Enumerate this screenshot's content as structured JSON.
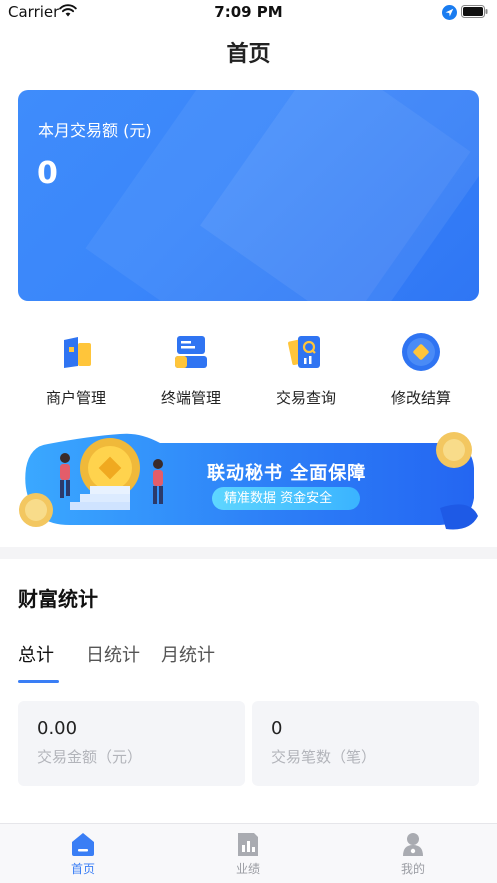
{
  "status_bar": {
    "carrier": "Carrier",
    "time": "7:09 PM"
  },
  "nav": {
    "title": "首页"
  },
  "summary_card": {
    "label": "本月交易额 (元)",
    "value": "0"
  },
  "quick_menu": [
    {
      "label": "商户管理",
      "icon": "merchant-icon"
    },
    {
      "label": "终端管理",
      "icon": "terminal-icon"
    },
    {
      "label": "交易查询",
      "icon": "transaction-search-icon"
    },
    {
      "label": "修改结算",
      "icon": "settlement-icon"
    }
  ],
  "banner": {
    "headline": "联动秘书 全面保障",
    "tagline": "精准数据 资金安全"
  },
  "wealth": {
    "title": "财富统计",
    "tabs": [
      "总计",
      "日统计",
      "月统计"
    ],
    "active_tab": "总计",
    "stats": [
      {
        "value": "0.00",
        "label": "交易金额（元）"
      },
      {
        "value": "0",
        "label": "交易笔数（笔）"
      }
    ]
  },
  "tab_bar": [
    {
      "label": "首页",
      "icon": "home-icon",
      "active": true
    },
    {
      "label": "业绩",
      "icon": "performance-icon",
      "active": false
    },
    {
      "label": "我的",
      "icon": "profile-icon",
      "active": false
    }
  ],
  "colors": {
    "accent": "#3a7ef5",
    "card_gradient_start": "#3f8cfb",
    "card_gradient_end": "#2f76f4"
  }
}
